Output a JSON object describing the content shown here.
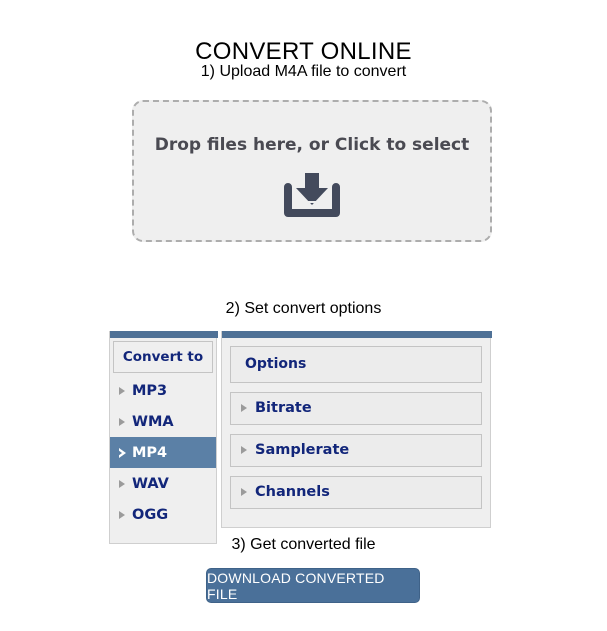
{
  "page": {
    "title": "CONVERT ONLINE"
  },
  "steps": {
    "step1": "1) Upload M4A file to convert",
    "step2": "2) Set convert options",
    "step3": "3) Get converted file"
  },
  "dropzone": {
    "text": "Drop files here, or Click to select",
    "icon": "download-tray-icon",
    "icon_color": "#434a5c",
    "fill_color": "#efefef",
    "border_color": "#adadad"
  },
  "sidebar": {
    "header": "Convert to",
    "accent_color": "#4f7196",
    "selected_color": "#5b80a6",
    "items": [
      {
        "label": "MP3",
        "selected": false
      },
      {
        "label": "WMA",
        "selected": false
      },
      {
        "label": "MP4",
        "selected": true
      },
      {
        "label": "WAV",
        "selected": false
      },
      {
        "label": "OGG",
        "selected": false
      }
    ]
  },
  "options": {
    "header": "Options",
    "accent_color": "#4f7196",
    "items": [
      {
        "label": "Bitrate"
      },
      {
        "label": "Samplerate"
      },
      {
        "label": "Channels"
      }
    ]
  },
  "download": {
    "label": "DOWNLOAD CONVERTED FILE",
    "color": "#4a7099"
  }
}
